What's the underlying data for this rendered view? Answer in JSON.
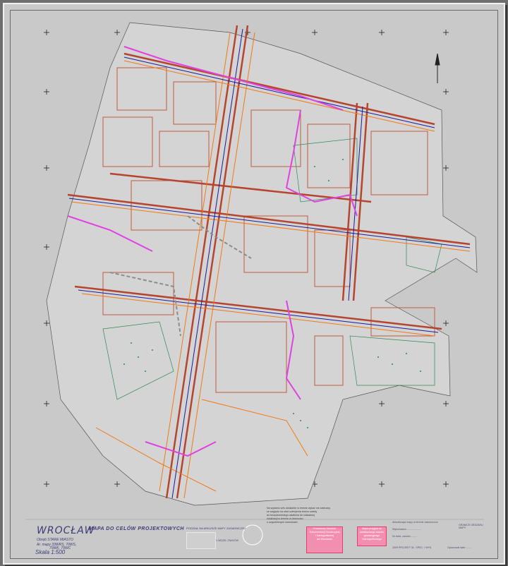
{
  "title_block": {
    "city": "WROCŁAW",
    "district": "Obręb STARE MIASTO",
    "sheet_numbers_line1": "Ar. mapy 33WRS, 70WS,",
    "sheet_numbers_line2": "79WK, 79WC",
    "scale": "Skala 1:500",
    "map_title": "MAPA DO CELÓW PROJEKTOWYCH",
    "index_label": "PODZIAŁ NA ARKUSZE MAPY ZASADNICZEJ",
    "index_grid_label": "1 WĘZEŁ ZNAKÓW",
    "stamp_left": [
      "Powiatowy Ośrodek",
      "Dokumentacji Geodezyjnej",
      "i Kartograficznej",
      "we Wrocławiu"
    ],
    "stamp_right": [
      "Mapa przyjęta do",
      "państwowego zasobu",
      "geodezyjnego",
      "i kartograficznego"
    ],
    "right_text_1": "Aktualizacja mapy w terenie zakończono",
    "right_text_2": "Wykonawca: ....................",
    "right_text_3": "Nr ewid. zasobu ........",
    "right_text_4": "2009 PROJEKT   GŁ. SPEC. / WYK.",
    "right_text_5": "Opracował  data  ........",
    "legend_text": "GRANICE OBSZARU MAPY"
  },
  "note": [
    "Na wydaniu w/w dokładnie w terenie wykaz nie zalecany",
    "ze względu na sieci uzbrojenia terenu należy",
    "do bezpośredniego ustalenia ich dokładnej",
    "lokalizacji w terenie w obecności",
    "o uzgodnionych warunkach."
  ],
  "colors": {
    "background": "#c9c9c9",
    "streets": "#b5452e",
    "utilities_orange": "#f07a12",
    "utilities_blue": "#1a1a9c",
    "boundary_magenta": "#e042e0",
    "greenery": "#2e8b57",
    "survey_grey": "#8c8c8c"
  }
}
